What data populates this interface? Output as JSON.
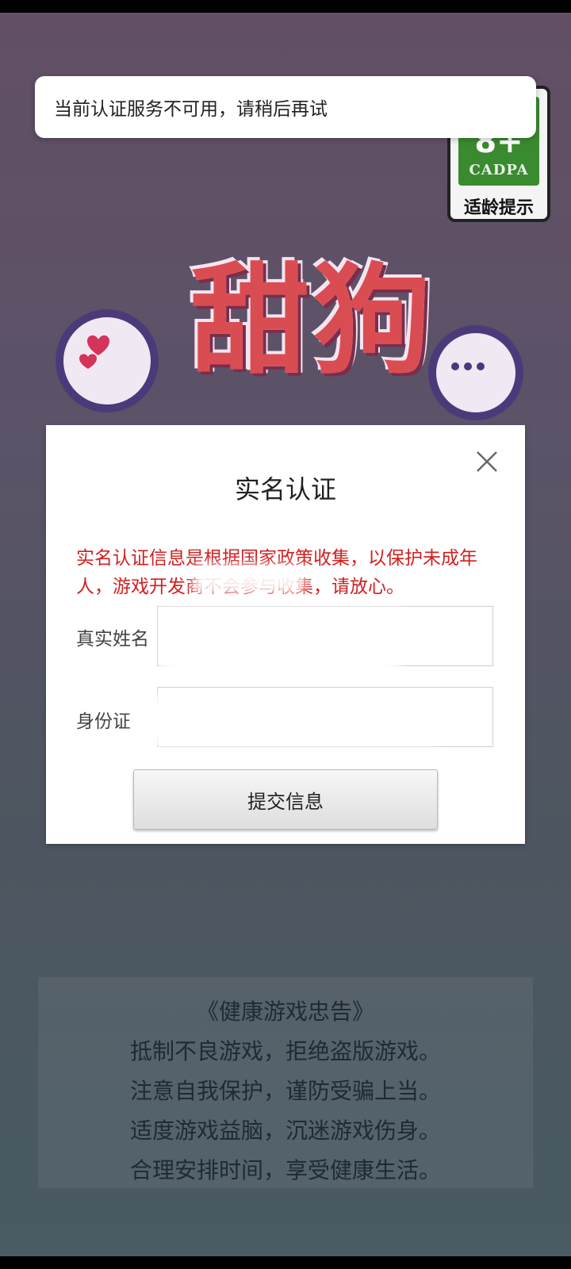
{
  "toast": {
    "message": "当前认证服务不可用，请稍后再试"
  },
  "age_rating": {
    "value": "8+",
    "org": "CADPA",
    "label": "适龄提示",
    "color": "#3a8a2f"
  },
  "logo": {
    "text": "甜狗"
  },
  "modal": {
    "title": "实名认证",
    "close_icon": "close-icon",
    "notice": "实名认证信息是根据国家政策收集，以保护未成年人，游戏开发商不会参与收集，请放心。",
    "name_field": {
      "label": "真实姓名",
      "value": ""
    },
    "id_field": {
      "label": "身份证",
      "value": ""
    },
    "submit_label": "提交信息"
  },
  "advisory": {
    "title": "《健康游戏忠告》",
    "lines": [
      "抵制不良游戏，拒绝盗版游戏。",
      "注意自我保护，谨防受骗上当。",
      "适度游戏益脑，沉迷游戏伤身。",
      "合理安排时间，享受健康生活。"
    ]
  },
  "colors": {
    "notice_red": "#d21f1f",
    "background_top": "#624f65",
    "background_bottom": "#495b63"
  }
}
